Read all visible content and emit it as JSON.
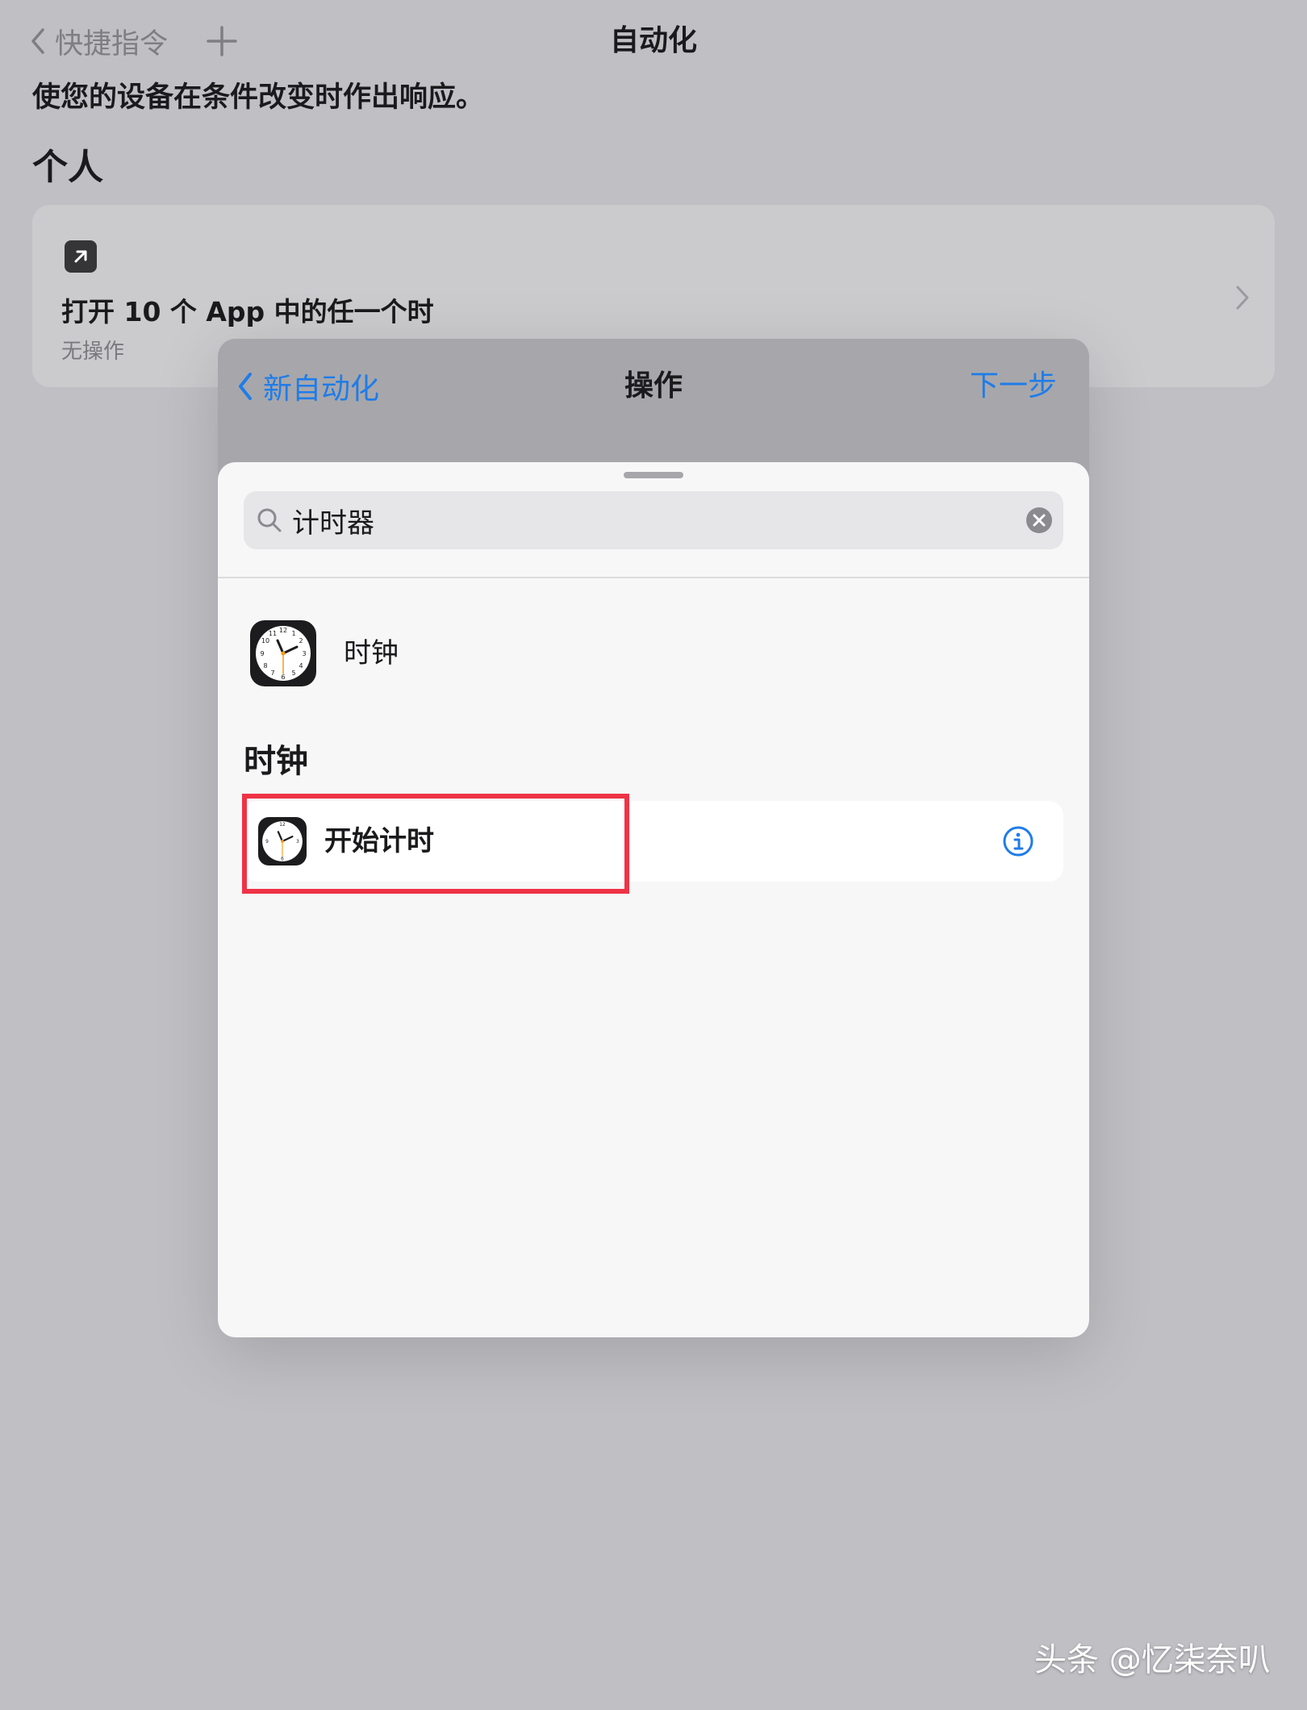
{
  "background": {
    "nav": {
      "back_label": "快捷指令",
      "title": "自动化"
    },
    "description": "使您的设备在条件改变时作出响应。",
    "section_title": "个人",
    "automation_card": {
      "title": "打开 10 个 App 中的任一个时",
      "subtitle": "无操作"
    }
  },
  "modal": {
    "back_label": "新自动化",
    "title": "操作",
    "next_label": "下一步",
    "search": {
      "value": "计时器"
    },
    "app_result": {
      "label": "时钟"
    },
    "section_title": "时钟",
    "action": {
      "label": "开始计时",
      "highlighted": true
    }
  },
  "colors": {
    "accent": "#1f7ce8",
    "highlight_border": "#ef3346"
  },
  "icons": [
    "chevron-left-icon",
    "plus-icon",
    "arrow-up-right-icon",
    "chevron-right-icon",
    "search-icon",
    "clear-icon",
    "clock-app-icon",
    "info-icon"
  ],
  "watermark": "头条 @忆柒奈叭"
}
